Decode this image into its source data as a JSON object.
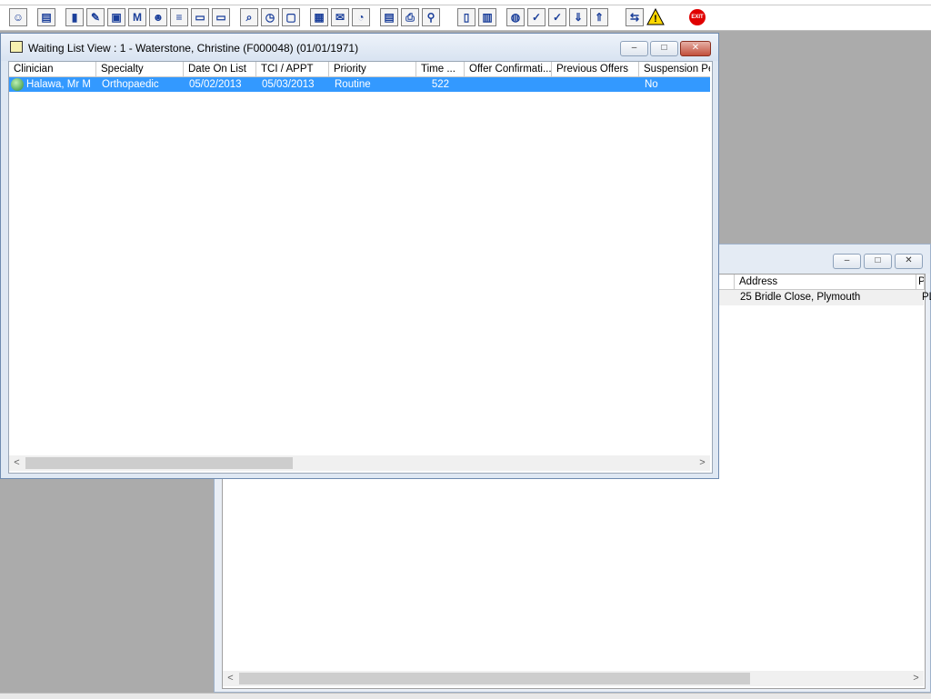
{
  "toolbar": {
    "icons": [
      "person-icon",
      "printer-icon",
      "book-icon",
      "edit-icon",
      "camera-icon",
      "m-icon",
      "doctor-icon",
      "notes-icon",
      "card-icon",
      "card2-icon",
      "search-icon",
      "clock-icon",
      "monitor-icon",
      "chart-icon",
      "letter-icon",
      "dial-icon",
      "note-icon",
      "print-icon",
      "bus-icon",
      "document-icon",
      "barchart-icon",
      "globe-icon",
      "check-icon",
      "check-down-icon",
      "download-icon",
      "upload-icon",
      "swap-icon",
      "warning-icon",
      "exit-icon"
    ],
    "exit_label": "EXIT",
    "warning_label": "!",
    "m_label": "M"
  },
  "main_window": {
    "title": "Waiting List View :  1 - Waterstone, Christine (F000048) (01/01/1971)",
    "columns": [
      "Clinician",
      "Specialty",
      "Date On List",
      "TCI / APPT",
      "Priority",
      "Time ...",
      "Offer Confirmati...",
      "Previous Offers",
      "Suspension Pe"
    ],
    "rows": [
      {
        "clinician": "Halawa, Mr M",
        "specialty": "Orthopaedic",
        "date_on_list": "05/02/2013",
        "tci_appt": "05/03/2013",
        "priority": "Routine",
        "time": "522",
        "offer_confirmation": "",
        "previous_offers": "",
        "suspension": "No"
      }
    ],
    "minimize": "–",
    "maximize": "□",
    "close": "✕"
  },
  "background_window": {
    "columns": [
      "Address",
      "Po"
    ],
    "rows": [
      {
        "address": "25 Bridle Close, Plymouth",
        "postcode": "PL"
      }
    ],
    "minimize": "–",
    "maximize": "□",
    "close": "✕"
  },
  "scroll": {
    "left": "<",
    "right": ">"
  }
}
